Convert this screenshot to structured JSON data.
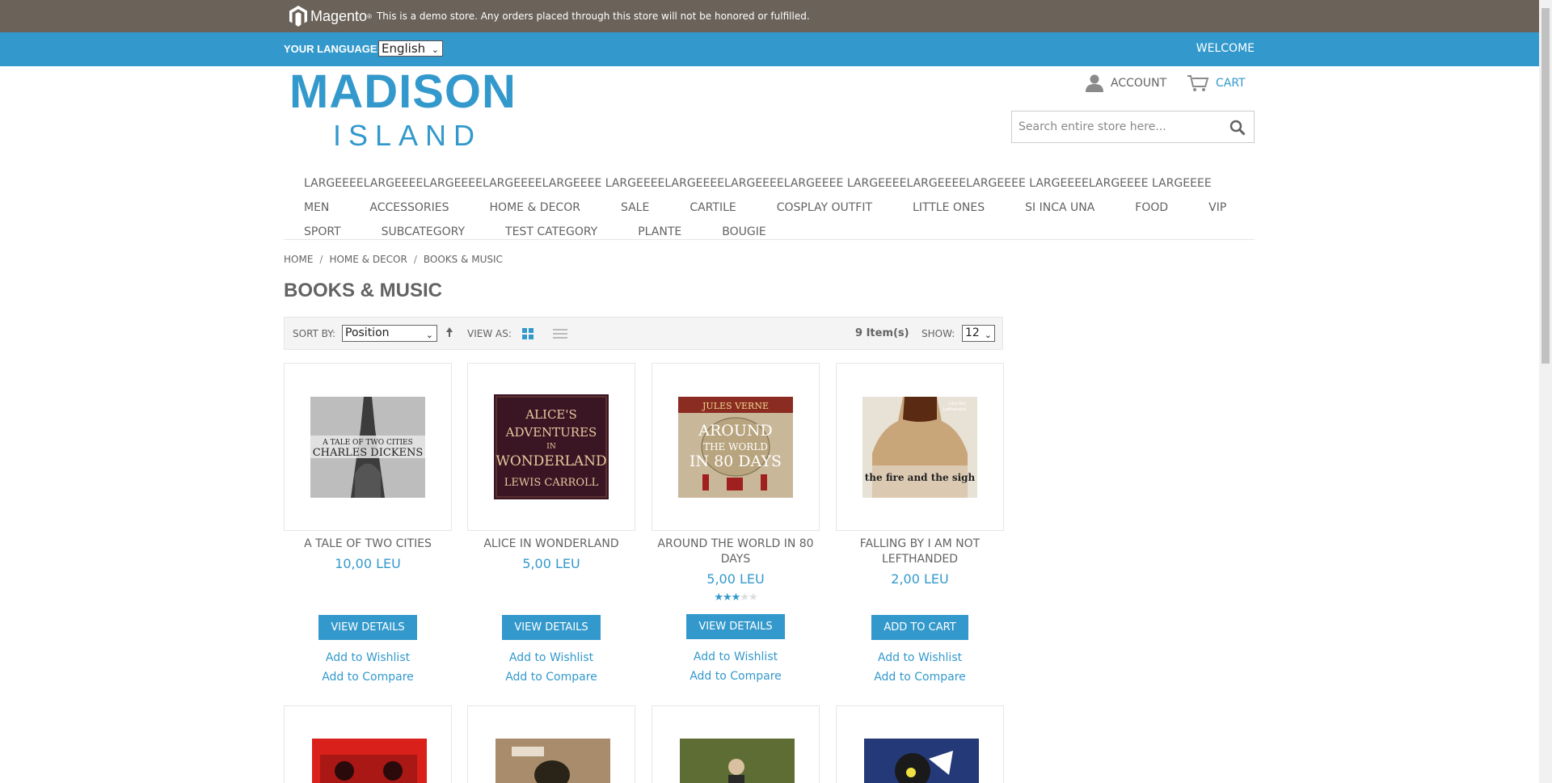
{
  "demo_notice": {
    "brand": "Magento",
    "text": "This is a demo store. Any orders placed through this store will not be honored or fulfilled."
  },
  "language_bar": {
    "label": "YOUR LANGUAGE:",
    "selected": "English",
    "welcome": "WELCOME"
  },
  "logo": {
    "line1": "MADISON",
    "line2": "ISLAND"
  },
  "header": {
    "account_label": "ACCOUNT",
    "cart_label": "CART",
    "search_placeholder": "Search entire store here..."
  },
  "nav": {
    "row1": [
      "LARGEEEELARGEEEELARGEEEELARGEEEELARGEEEE LARGEEEELARGEEEELARGEEEELARGEEEE LARGEEEELARGEEEELARGEEEE LARGEEEELARGEEEE LARGEEEE"
    ],
    "row2": [
      "MEN",
      "ACCESSORIES",
      "HOME & DECOR",
      "SALE",
      "CARTILE",
      "COSPLAY OUTFIT",
      "LITTLE ONES",
      "SI INCA UNA",
      "FOOD",
      "VIP"
    ],
    "row3": [
      "SPORT",
      "SUBCATEGORY",
      "TEST CATEGORY",
      "PLANTE",
      "BOUGIE"
    ]
  },
  "breadcrumb": [
    "HOME",
    "HOME & DECOR",
    "BOOKS & MUSIC"
  ],
  "page_title": "BOOKS & MUSIC",
  "toolbar": {
    "sort_label": "SORT BY:",
    "sort_selected": "Position",
    "view_label": "VIEW AS:",
    "items_count": "9 Item(s)",
    "show_label": "SHOW:",
    "show_selected": "12"
  },
  "products": [
    {
      "name": "A TALE OF TWO CITIES",
      "price": "10,00 LEU",
      "action": "VIEW DETAILS",
      "wishlist": "Add to Wishlist",
      "compare": "Add to Compare",
      "cover_title": "A TALE OF TWO CITIES",
      "cover_author": "CHARLES DICKENS"
    },
    {
      "name": "ALICE IN WONDERLAND",
      "price": "5,00 LEU",
      "action": "VIEW DETAILS",
      "wishlist": "Add to Wishlist",
      "compare": "Add to Compare",
      "cover_title": "ALICE'S ADVENTURES IN WONDERLAND",
      "cover_author": "LEWIS CARROLL"
    },
    {
      "name": "AROUND THE WORLD IN 80 DAYS",
      "price": "5,00 LEU",
      "rating": 3,
      "action": "VIEW DETAILS",
      "wishlist": "Add to Wishlist",
      "compare": "Add to Compare",
      "cover_title": "AROUND THE WORLD IN 80 DAYS",
      "cover_author": "JULES VERNE"
    },
    {
      "name": "FALLING BY I AM NOT LEFTHANDED",
      "price": "2,00 LEU",
      "action": "ADD TO CART",
      "wishlist": "Add to Wishlist",
      "compare": "Add to Compare",
      "cover_title": "the fire and the sigh",
      "cover_author": "I Am Not Lefthanded"
    }
  ],
  "colors": {
    "accent": "#3399cc",
    "demo_bar": "#6b635a",
    "text": "#636363"
  }
}
